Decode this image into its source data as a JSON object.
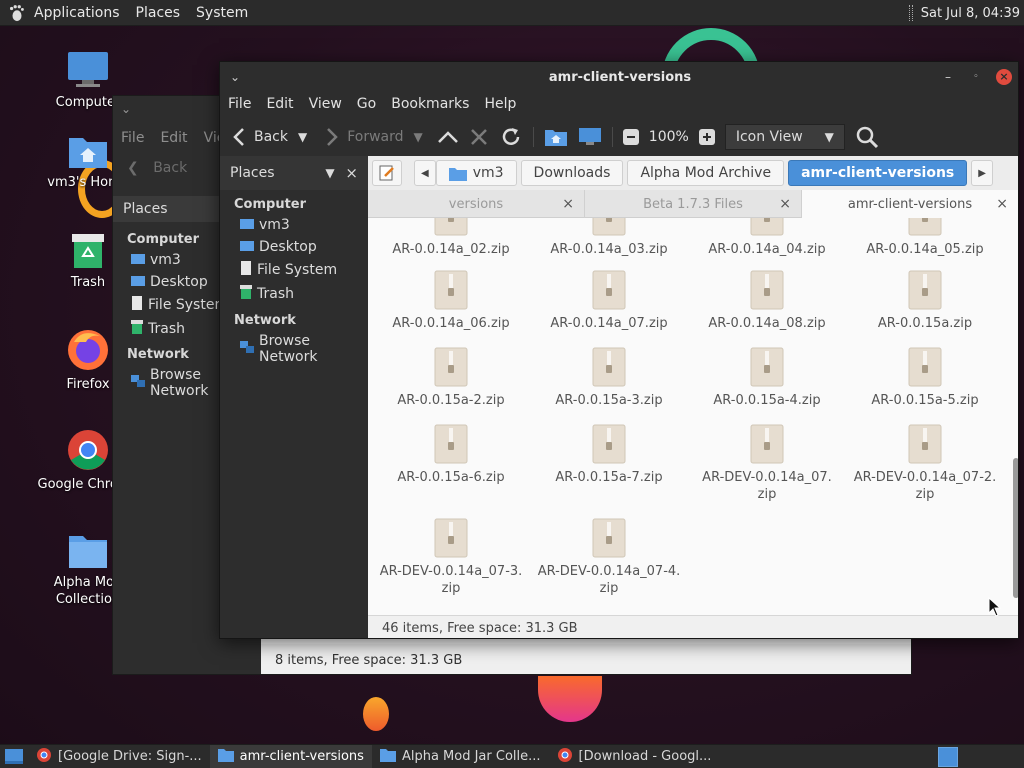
{
  "top_panel": {
    "menu": [
      "Applications",
      "Places",
      "System"
    ],
    "clock": "Sat Jul 8, 04:39"
  },
  "desktop_icons": [
    {
      "label": "Computer",
      "icon": "monitor-icon"
    },
    {
      "label": "vm3's Home",
      "icon": "home-folder-icon"
    },
    {
      "label": "Trash",
      "icon": "trash-icon"
    },
    {
      "label": "Firefox",
      "icon": "firefox-icon"
    },
    {
      "label": "Google Chrome",
      "icon": "chrome-icon"
    },
    {
      "label": "Alpha Mod Collection",
      "icon": "folder-icon"
    }
  ],
  "back_window": {
    "menu": [
      "File",
      "Edit",
      "View"
    ],
    "nav_back": "Back",
    "places_label": "Places",
    "sidebar": {
      "computer_heading": "Computer",
      "items": [
        "vm3",
        "Desktop",
        "File System",
        "Trash"
      ],
      "network_heading": "Network",
      "network_items": [
        "Browse Network"
      ]
    },
    "status": "8 items, Free space: 31.3 GB"
  },
  "main_window": {
    "title": "amr-client-versions",
    "menu": [
      "File",
      "Edit",
      "View",
      "Go",
      "Bookmarks",
      "Help"
    ],
    "toolbar": {
      "back": "Back",
      "forward": "Forward",
      "zoom": "100%",
      "view_mode": "Icon View"
    },
    "sidebar": {
      "header": "Places",
      "computer_heading": "Computer",
      "items": [
        "vm3",
        "Desktop",
        "File System",
        "Trash"
      ],
      "network_heading": "Network",
      "network_items": [
        "Browse Network"
      ]
    },
    "pathbar": [
      "vm3",
      "Downloads",
      "Alpha Mod Archive",
      "amr-client-versions"
    ],
    "tabs": [
      {
        "label": "versions",
        "active": false
      },
      {
        "label": "Beta 1.7.3 Files",
        "active": false
      },
      {
        "label": "amr-client-versions",
        "active": true
      }
    ],
    "files": [
      "AR-0.0.14a_02.zip",
      "AR-0.0.14a_03.zip",
      "AR-0.0.14a_04.zip",
      "AR-0.0.14a_05.zip",
      "AR-0.0.14a_06.zip",
      "AR-0.0.14a_07.zip",
      "AR-0.0.14a_08.zip",
      "AR-0.0.15a.zip",
      "AR-0.0.15a-2.zip",
      "AR-0.0.15a-3.zip",
      "AR-0.0.15a-4.zip",
      "AR-0.0.15a-5.zip",
      "AR-0.0.15a-6.zip",
      "AR-0.0.15a-7.zip",
      "AR-DEV-0.0.14a_07.zip",
      "AR-DEV-0.0.14a_07-2.zip",
      "AR-DEV-0.0.14a_07-3.zip",
      "AR-DEV-0.0.14a_07-4.zip"
    ],
    "status": "46 items, Free space: 31.3 GB"
  },
  "taskbar": [
    {
      "label": "[Google Drive: Sign-...",
      "icon": "chrome-icon",
      "active": false
    },
    {
      "label": "amr-client-versions",
      "icon": "folder-icon",
      "active": true
    },
    {
      "label": "Alpha Mod Jar Colle...",
      "icon": "folder-icon",
      "active": false
    },
    {
      "label": "[Download - Googl...",
      "icon": "chrome-icon",
      "active": false
    }
  ],
  "colors": {
    "accent": "#4a90d9",
    "panel": "#2b2b2b",
    "window": "#2d2d2d",
    "content": "#fafafa",
    "close": "#e04b3e"
  }
}
